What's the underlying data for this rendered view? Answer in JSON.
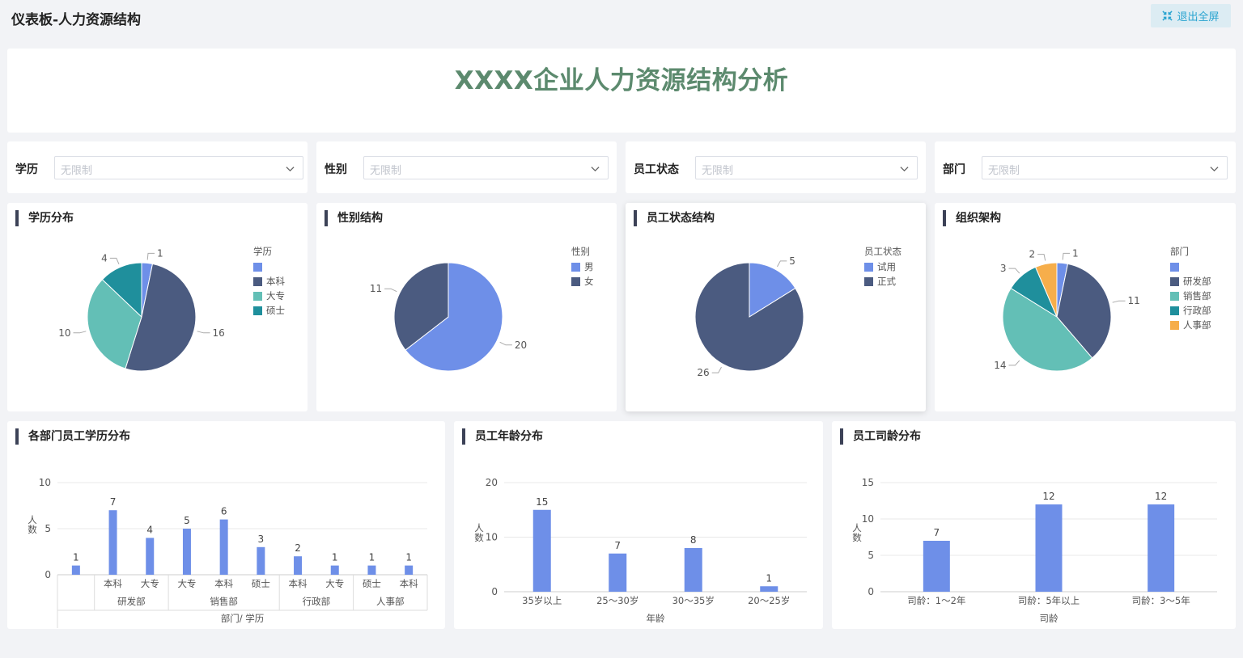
{
  "header": {
    "title": "仪表板-人力资源结构",
    "exit_label": "退出全屏"
  },
  "banner": {
    "title": "XXXX企业人力资源结构分析"
  },
  "filters": [
    {
      "label": "学历",
      "placeholder": "无限制"
    },
    {
      "label": "性别",
      "placeholder": "无限制"
    },
    {
      "label": "员工状态",
      "placeholder": "无限制"
    },
    {
      "label": "部门",
      "placeholder": "无限制"
    }
  ],
  "colors": {
    "accent": "#2aa4d0",
    "title_green": "#5c8a6e",
    "bar": "#6e8fe8"
  },
  "chart_data": [
    {
      "id": "edu",
      "type": "pie",
      "title": "学历分布",
      "legend_title": "学历",
      "categories": [
        "",
        "本科",
        "大专",
        "硕士"
      ],
      "values": [
        1,
        16,
        10,
        4
      ],
      "colors": [
        "#6e8fe8",
        "#4b5b80",
        "#63bfb6",
        "#1f8f9c"
      ]
    },
    {
      "id": "gender",
      "type": "pie",
      "title": "性别结构",
      "legend_title": "性别",
      "categories": [
        "男",
        "女"
      ],
      "values": [
        20,
        11
      ],
      "colors": [
        "#6e8fe8",
        "#4b5b80"
      ]
    },
    {
      "id": "status",
      "type": "pie",
      "title": "员工状态结构",
      "legend_title": "员工状态",
      "categories": [
        "试用",
        "正式"
      ],
      "values": [
        5,
        26
      ],
      "colors": [
        "#6e8fe8",
        "#4b5b80"
      ]
    },
    {
      "id": "org",
      "type": "pie",
      "title": "组织架构",
      "legend_title": "部门",
      "categories": [
        "",
        "研发部",
        "销售部",
        "行政部",
        "人事部"
      ],
      "values": [
        1,
        11,
        14,
        3,
        2
      ],
      "colors": [
        "#6e8fe8",
        "#4b5b80",
        "#63bfb6",
        "#1f8f9c",
        "#f6ae4b"
      ]
    },
    {
      "id": "dept_edu",
      "type": "bar",
      "title": "各部门员工学历分布",
      "categories": [
        "",
        "本科",
        "大专",
        "大专",
        "本科",
        "硕士",
        "本科",
        "大专",
        "硕士",
        "本科"
      ],
      "groups": [
        {
          "name": "",
          "span": 1
        },
        {
          "name": "研发部",
          "span": 2
        },
        {
          "name": "销售部",
          "span": 3
        },
        {
          "name": "行政部",
          "span": 2
        },
        {
          "name": "人事部",
          "span": 2
        }
      ],
      "values": [
        1,
        7,
        4,
        5,
        6,
        3,
        2,
        1,
        1,
        1
      ],
      "ylim": [
        0,
        10
      ],
      "yticks": [
        0,
        5,
        10
      ],
      "xlabel": "部门/ 学历",
      "ylabel": "人数"
    },
    {
      "id": "age",
      "type": "bar",
      "title": "员工年龄分布",
      "categories": [
        "35岁以上",
        "25～30岁",
        "30～35岁",
        "20～25岁"
      ],
      "values": [
        15,
        7,
        8,
        1
      ],
      "ylim": [
        0,
        20
      ],
      "yticks": [
        0,
        10,
        20
      ],
      "xlabel": "年龄",
      "ylabel": "人数"
    },
    {
      "id": "tenure",
      "type": "bar",
      "title": "员工司龄分布",
      "categories": [
        "司龄：1～2年",
        "司龄：5年以上",
        "司龄：3～5年"
      ],
      "values": [
        7,
        12,
        12
      ],
      "ylim": [
        0,
        15
      ],
      "yticks": [
        0,
        5,
        10,
        15
      ],
      "xlabel": "司龄",
      "ylabel": "人数"
    }
  ]
}
